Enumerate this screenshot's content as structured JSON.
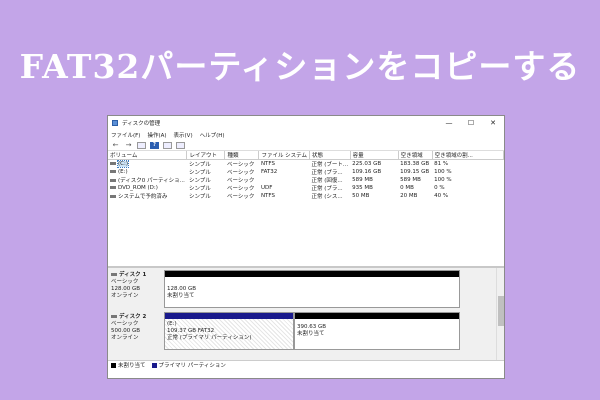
{
  "banner": {
    "title": "FAT32パーティションをコピーする"
  },
  "window": {
    "title": "ディスクの管理",
    "controls": {
      "minimize": "—",
      "maximize": "☐",
      "close": "✕"
    },
    "menu": [
      "ファイル(F)",
      "操作(A)",
      "表示(V)",
      "ヘルプ(H)"
    ],
    "toolbar": [
      "back-icon",
      "forward-icon",
      "grid-icon",
      "help-icon",
      "list-icon",
      "panel-icon"
    ]
  },
  "volumes": {
    "headers": [
      "ボリューム",
      "レイアウト",
      "種類",
      "ファイル システム",
      "状態",
      "容量",
      "空き領域",
      "空き領域の割..."
    ],
    "rows": [
      [
        "(C:)",
        "シンプル",
        "ベーシック",
        "NTFS",
        "正常 (ブート...",
        "225.03 GB",
        "183.38 GB",
        "81 %"
      ],
      [
        "(E:)",
        "シンプル",
        "ベーシック",
        "FAT32",
        "正常 (プラ...",
        "109.16 GB",
        "109.15 GB",
        "100 %"
      ],
      [
        "(ディスク0 パーティショ...",
        "シンプル",
        "ベーシック",
        "",
        "正常 (回復...",
        "589 MB",
        "589 MB",
        "100 %"
      ],
      [
        "DVD_ROM (D:)",
        "シンプル",
        "ベーシック",
        "UDF",
        "正常 (プラ...",
        "935 MB",
        "0 MB",
        "0 %"
      ],
      [
        "システムで予約済み",
        "シンプル",
        "ベーシック",
        "NTFS",
        "正常 (シス...",
        "50 MB",
        "20 MB",
        "40 %"
      ]
    ]
  },
  "disks": [
    {
      "name": "ディスク 1",
      "type": "ベーシック",
      "size": "128.00 GB",
      "status": "オンライン",
      "partitions": [
        {
          "line1": "128.00 GB",
          "line2": "未割り当て",
          "kind": "unallocated"
        }
      ]
    },
    {
      "name": "ディスク 2",
      "type": "ベーシック",
      "size": "500.00 GB",
      "status": "オンライン",
      "partitions": [
        {
          "line1": "(E:)",
          "line2": "109.37 GB FAT32",
          "line3": "正常 (プライマリ パーティション)",
          "kind": "primary"
        },
        {
          "line1": "390.63 GB",
          "line2": "未割り当て",
          "kind": "unallocated"
        }
      ]
    }
  ],
  "legend": {
    "unallocated": "未割り当て",
    "primary": "プライマリ パーティション"
  },
  "colors": {
    "background": "#c3a5e8",
    "unallocated": "#000000",
    "primary": "#1a1a8c"
  }
}
